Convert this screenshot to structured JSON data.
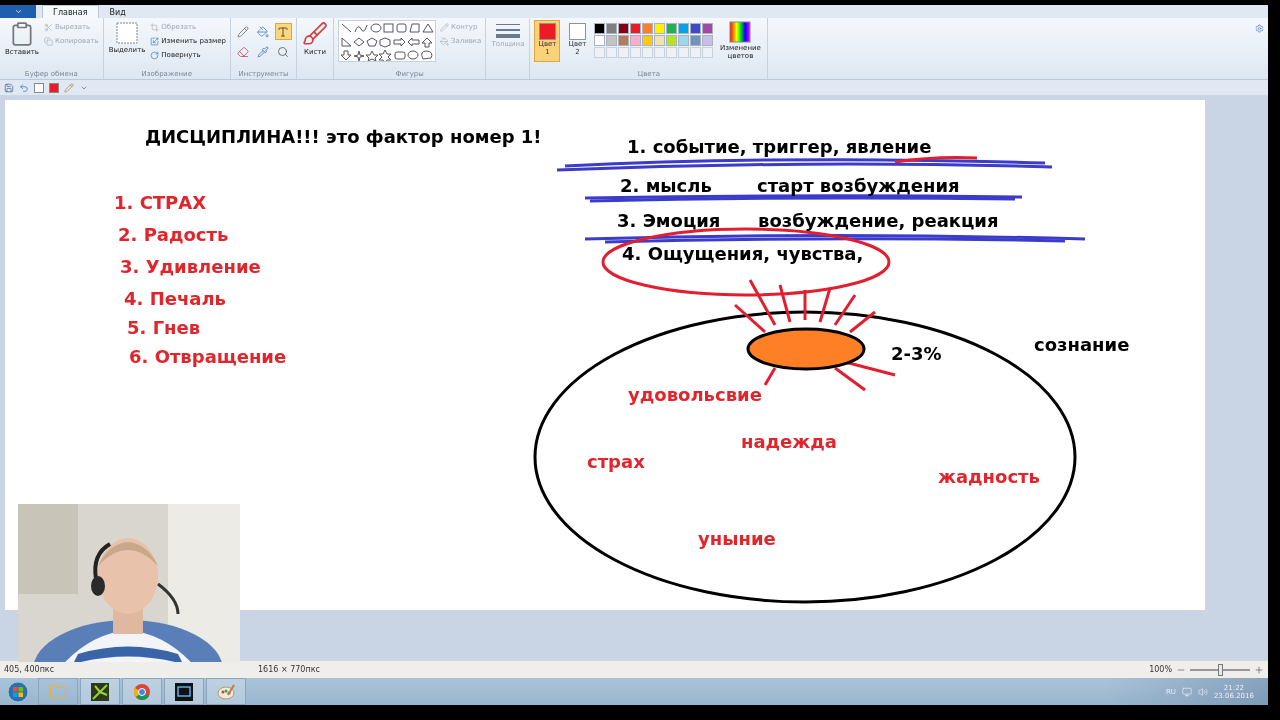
{
  "tabs": [
    {
      "label": "Главная",
      "selected": true
    },
    {
      "label": "Вид",
      "selected": false
    }
  ],
  "clipboard": {
    "group": "Буфер обмена",
    "paste": "Вставить",
    "cut": {
      "label": "Вырезать",
      "disabled": true
    },
    "copy": {
      "label": "Копировать",
      "disabled": true
    }
  },
  "image": {
    "group": "Изображение",
    "select": "Выделить",
    "crop": {
      "label": "Обрезать",
      "disabled": true
    },
    "resize": {
      "label": "Изменить размер",
      "disabled": false
    },
    "rotate": {
      "label": "Повернуть",
      "disabled": false
    }
  },
  "tools": {
    "group": "Инструменты",
    "items": [
      {
        "kind": "pencil",
        "selected": false
      },
      {
        "kind": "fill",
        "selected": false
      },
      {
        "kind": "text",
        "selected": true
      },
      {
        "kind": "eraser",
        "selected": false
      },
      {
        "kind": "picker",
        "selected": false
      },
      {
        "kind": "magnifier",
        "selected": false
      }
    ]
  },
  "brushes": "Кисти",
  "shapes": {
    "group": "Фигуры",
    "outline": {
      "label": "Контур",
      "disabled": true
    },
    "fill": {
      "label": "Заливка",
      "disabled": true
    }
  },
  "thickness": {
    "label": "Толщина",
    "disabled": true
  },
  "colors": {
    "group": "Цвета",
    "slots": [
      {
        "label": "Цвет",
        "index": "1",
        "color": "#ed1c24",
        "selected": true
      },
      {
        "label": "Цвет",
        "index": "2",
        "color": "#ffffff",
        "selected": false
      }
    ],
    "palette": [
      {
        "color": "#000000"
      },
      {
        "color": "#7f7f7f"
      },
      {
        "color": "#880015"
      },
      {
        "color": "#ed1c24"
      },
      {
        "color": "#ff7f27"
      },
      {
        "color": "#fff200"
      },
      {
        "color": "#22b14c"
      },
      {
        "color": "#00a2e8"
      },
      {
        "color": "#3f48cc"
      },
      {
        "color": "#a349a4"
      },
      {
        "color": "#ffffff"
      },
      {
        "color": "#c3c3c3"
      },
      {
        "color": "#b97a57"
      },
      {
        "color": "#ffaec9"
      },
      {
        "color": "#ffc90e"
      },
      {
        "color": "#efe4b0"
      },
      {
        "color": "#b5e61d"
      },
      {
        "color": "#99d9ea"
      },
      {
        "color": "#7092be"
      },
      {
        "color": "#c8bfe7"
      }
    ],
    "edit": "Изменение цветов"
  },
  "canvas": {
    "title": "ДИСЦИПЛИНА!!! это фактор номер 1!",
    "emotions": [
      "1. СТРАХ",
      "2. Радость",
      "3. Удивление",
      "4. Печаль",
      "5. Гнев",
      "6. Отвращение"
    ],
    "chain": [
      "1. событие, триггер, явление",
      "2. мысль",
      "старт возбуждения",
      "3. Эмоция",
      "возбуждение, реакция",
      "4. Ощущения, чувства,"
    ],
    "spot_label": "2-3%",
    "circle_label": "сознание",
    "inside": [
      "удовольсвие",
      "надежда",
      "страх",
      "жадность",
      "уныние"
    ]
  },
  "status_bar": {
    "position": "405, 400пкс",
    "size": "1616 × 770пкс",
    "zoom": "100%",
    "level": 0.5
  },
  "taskbar": {
    "apps": [
      {
        "kind": "explorer"
      },
      {
        "kind": "tool"
      },
      {
        "kind": "browser"
      },
      {
        "kind": "screen"
      },
      {
        "kind": "paint"
      }
    ],
    "language": "RU",
    "time": "21:22",
    "date": "23.06.2016"
  }
}
